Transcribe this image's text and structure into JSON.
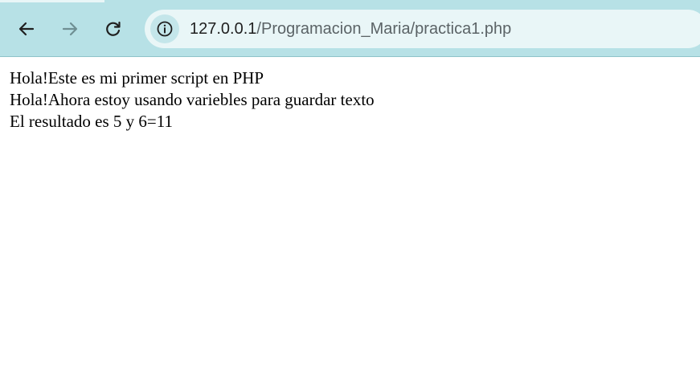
{
  "browser": {
    "url_host": "127.0.0.1",
    "url_path": "/Programacion_Maria/practica1.php",
    "icons": {
      "back": "arrow-left-icon",
      "forward": "arrow-right-icon",
      "reload": "reload-icon",
      "site_info": "info-icon"
    },
    "colors": {
      "toolbar_bg": "#b7e1e6",
      "omnibox_bg": "#e9f6f7"
    }
  },
  "page": {
    "lines": [
      "Hola!Este es mi primer script en PHP",
      "Hola!Ahora estoy usando variebles para guardar texto",
      "El resultado es 5 y 6=11"
    ]
  }
}
